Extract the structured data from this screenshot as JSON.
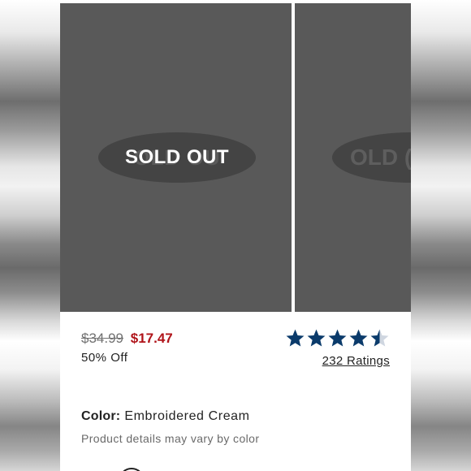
{
  "gallery": {
    "images": [
      {
        "badge": "SOLD OUT",
        "ghost_text": "OLD OU"
      },
      {
        "ghost_text": "OLD ( "
      }
    ]
  },
  "pricing": {
    "original_price": "$34.99",
    "sale_price": "$17.47",
    "discount": "50% Off"
  },
  "rating": {
    "stars_value": 4.5,
    "stars_max": 5,
    "ratings_link": "232 Ratings"
  },
  "color": {
    "label": "Color:",
    "value": "Embroidered Cream",
    "note": "Product details may vary by color"
  },
  "colors": {
    "sale_red": "#b0141a",
    "star_navy": "#0b3b6b",
    "image_gray": "#595959"
  },
  "icons": {
    "star": "star-icon",
    "half_star": "half-star-icon",
    "swatch": "color-swatch"
  }
}
